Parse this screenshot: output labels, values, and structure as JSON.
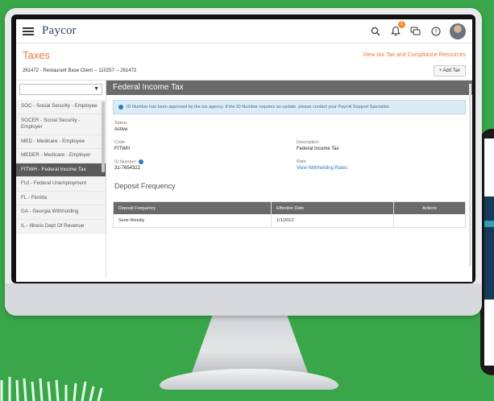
{
  "header": {
    "logo": "Paycor",
    "notification_count": "1"
  },
  "page": {
    "title": "Taxes",
    "resources_link": "View our Tax and Compliance Resources",
    "client": "261472 - Restaurant Base Client -- 110257 -- 261472",
    "add_tax_label": "+ Add Tax"
  },
  "sidebar": {
    "filter_value": "",
    "items": [
      {
        "label": "SOC - Social Security - Employee"
      },
      {
        "label": "SOCER - Social Security - Employer"
      },
      {
        "label": "MED - Medicare - Employee"
      },
      {
        "label": "MEDER - Medicare - Employer"
      },
      {
        "label": "FITWH - Federal Income Tax",
        "active": true
      },
      {
        "label": "FUI - Federal Unemployment"
      },
      {
        "label": "FL - Florida"
      },
      {
        "label": "GA - Georgia Withholding"
      },
      {
        "label": "IL - Illinois Dept Of Revenue"
      }
    ]
  },
  "detail": {
    "heading": "Federal Income Tax",
    "info_message": "ID Number has been approved by the tax agency. If the ID Number requires an update, please contact your Payroll Support Specialist.",
    "status_label": "Status",
    "status_value": "Active",
    "code_label": "Code",
    "code_value": "FITWH",
    "description_label": "Description",
    "description_value": "Federal Income Tax",
    "id_label": "ID Number",
    "id_value": "31-7654322",
    "rate_label": "Rate",
    "rate_value": "View Withholding Rates",
    "deposit_title": "Deposit Frequency",
    "table": {
      "columns": [
        "Deposit Frequency",
        "Effective Date",
        "Actions"
      ],
      "rows": [
        [
          "Semi-Weekly",
          "1/1/2012",
          ""
        ]
      ]
    }
  }
}
